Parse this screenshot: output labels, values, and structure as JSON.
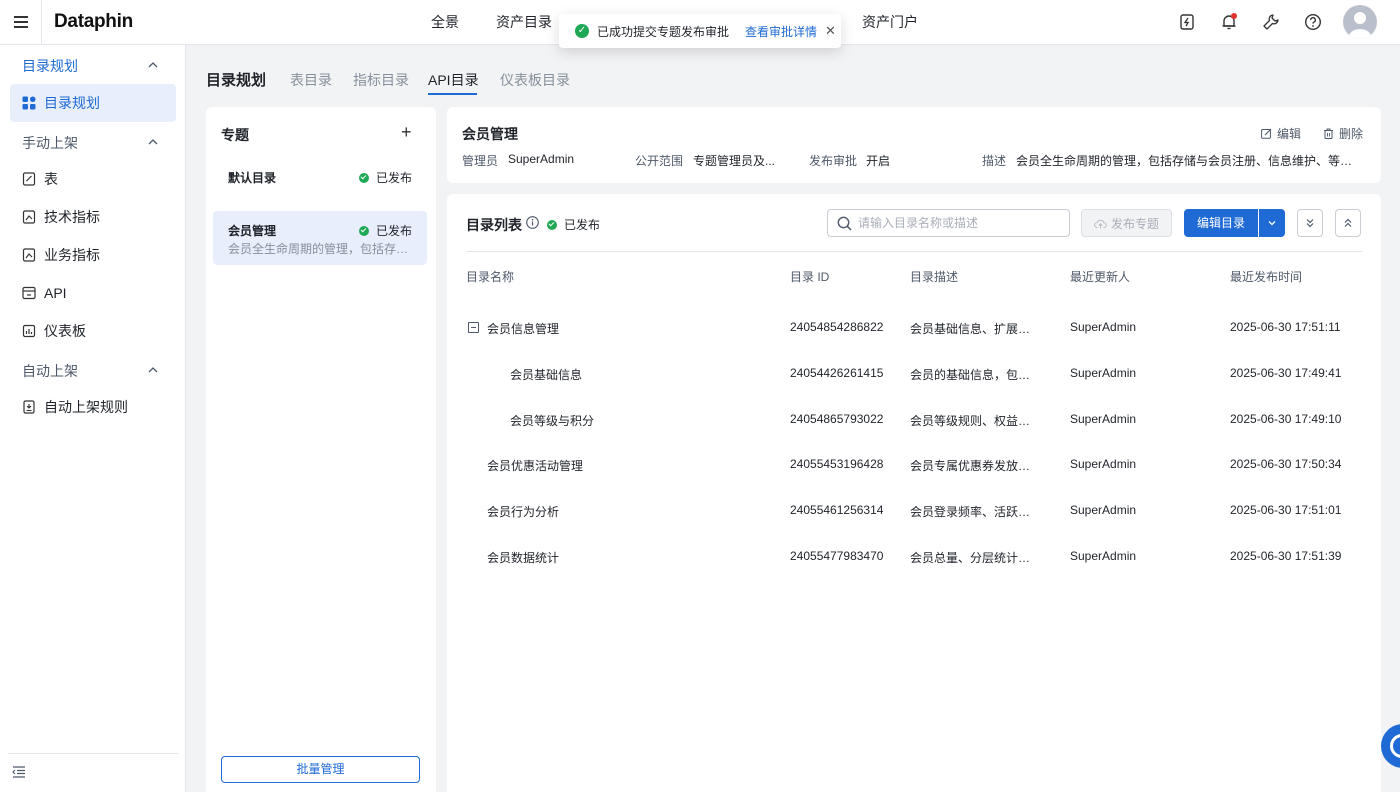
{
  "app": {
    "logo": "Dataphin"
  },
  "topnav": {
    "items": [
      "全景",
      "资产目录",
      "资产门户"
    ]
  },
  "toast": {
    "message": "已成功提交专题发布审批",
    "link": "查看审批详情"
  },
  "sidebar": {
    "groups": [
      {
        "label": "目录规划",
        "active": true
      },
      {
        "label": "手动上架"
      },
      {
        "label": "自动上架"
      }
    ],
    "items": [
      {
        "label": "目录规划",
        "icon": "grid-icon",
        "active": true
      },
      {
        "label": "表",
        "icon": "table-icon"
      },
      {
        "label": "技术指标",
        "icon": "tech-metric-icon"
      },
      {
        "label": "业务指标",
        "icon": "biz-metric-icon"
      },
      {
        "label": "API",
        "icon": "api-icon"
      },
      {
        "label": "仪表板",
        "icon": "dashboard-icon"
      },
      {
        "label": "自动上架规则",
        "icon": "rule-icon"
      }
    ]
  },
  "page": {
    "title": "目录规划",
    "tabs": [
      {
        "label": "表目录"
      },
      {
        "label": "指标目录"
      },
      {
        "label": "API目录",
        "active": true
      },
      {
        "label": "仪表板目录"
      }
    ]
  },
  "topics": {
    "title": "专题",
    "items": [
      {
        "name": "默认目录",
        "status": "已发布",
        "desc": ""
      },
      {
        "name": "会员管理",
        "status": "已发布",
        "desc": "会员全生命周期的管理，包括存储与会员注册、信息维护、等级体系等",
        "selected": true
      }
    ],
    "batch_label": "批量管理"
  },
  "info": {
    "title": "会员管理",
    "edit_label": "编辑",
    "delete_label": "删除",
    "fields": [
      {
        "label": "管理员",
        "value": "SuperAdmin"
      },
      {
        "label": "公开范围",
        "value": "专题管理员及..."
      },
      {
        "label": "发布审批",
        "value": "开启"
      },
      {
        "label": "描述",
        "value": "会员全生命周期的管理，包括存储与会员注册、信息维护、等级体系等"
      }
    ]
  },
  "list": {
    "title": "目录列表",
    "status": "已发布",
    "search_placeholder": "请输入目录名称或描述",
    "publish_label": "发布专题",
    "edit_label": "编辑目录",
    "columns": [
      "目录名称",
      "目录 ID",
      "目录描述",
      "最近更新人",
      "最近发布时间"
    ],
    "rows": [
      {
        "name": "会员信息管理",
        "level": 0,
        "expanded": true,
        "id": "24054854286822",
        "desc": "会员基础信息、扩展属性",
        "updater": "SuperAdmin",
        "time": "2025-06-30 17:51:11"
      },
      {
        "name": "会员基础信息",
        "level": 1,
        "id": "24054426261415",
        "desc": "会员的基础信息，包括姓名、性别等",
        "updater": "SuperAdmin",
        "time": "2025-06-30 17:49:41"
      },
      {
        "name": "会员等级与积分",
        "level": 1,
        "id": "24054865793022",
        "desc": "会员等级规则、权益查询",
        "updater": "SuperAdmin",
        "time": "2025-06-30 17:49:10"
      },
      {
        "name": "会员优惠活动管理",
        "level": 0,
        "id": "24055453196428",
        "desc": "会员专属优惠券发放、使用记录",
        "updater": "SuperAdmin",
        "time": "2025-06-30 17:50:34"
      },
      {
        "name": "会员行为分析",
        "level": 0,
        "id": "24055461256314",
        "desc": "会员登录频率、活跃时段分析",
        "updater": "SuperAdmin",
        "time": "2025-06-30 17:51:01"
      },
      {
        "name": "会员数据统计",
        "level": 0,
        "id": "24055477983470",
        "desc": "会员总量、分层统计（新老会员）",
        "updater": "SuperAdmin",
        "time": "2025-06-30 17:51:39"
      }
    ]
  },
  "colors": {
    "primary": "#1f6ad4",
    "success": "#1fa855",
    "badge": "#e5322d"
  }
}
